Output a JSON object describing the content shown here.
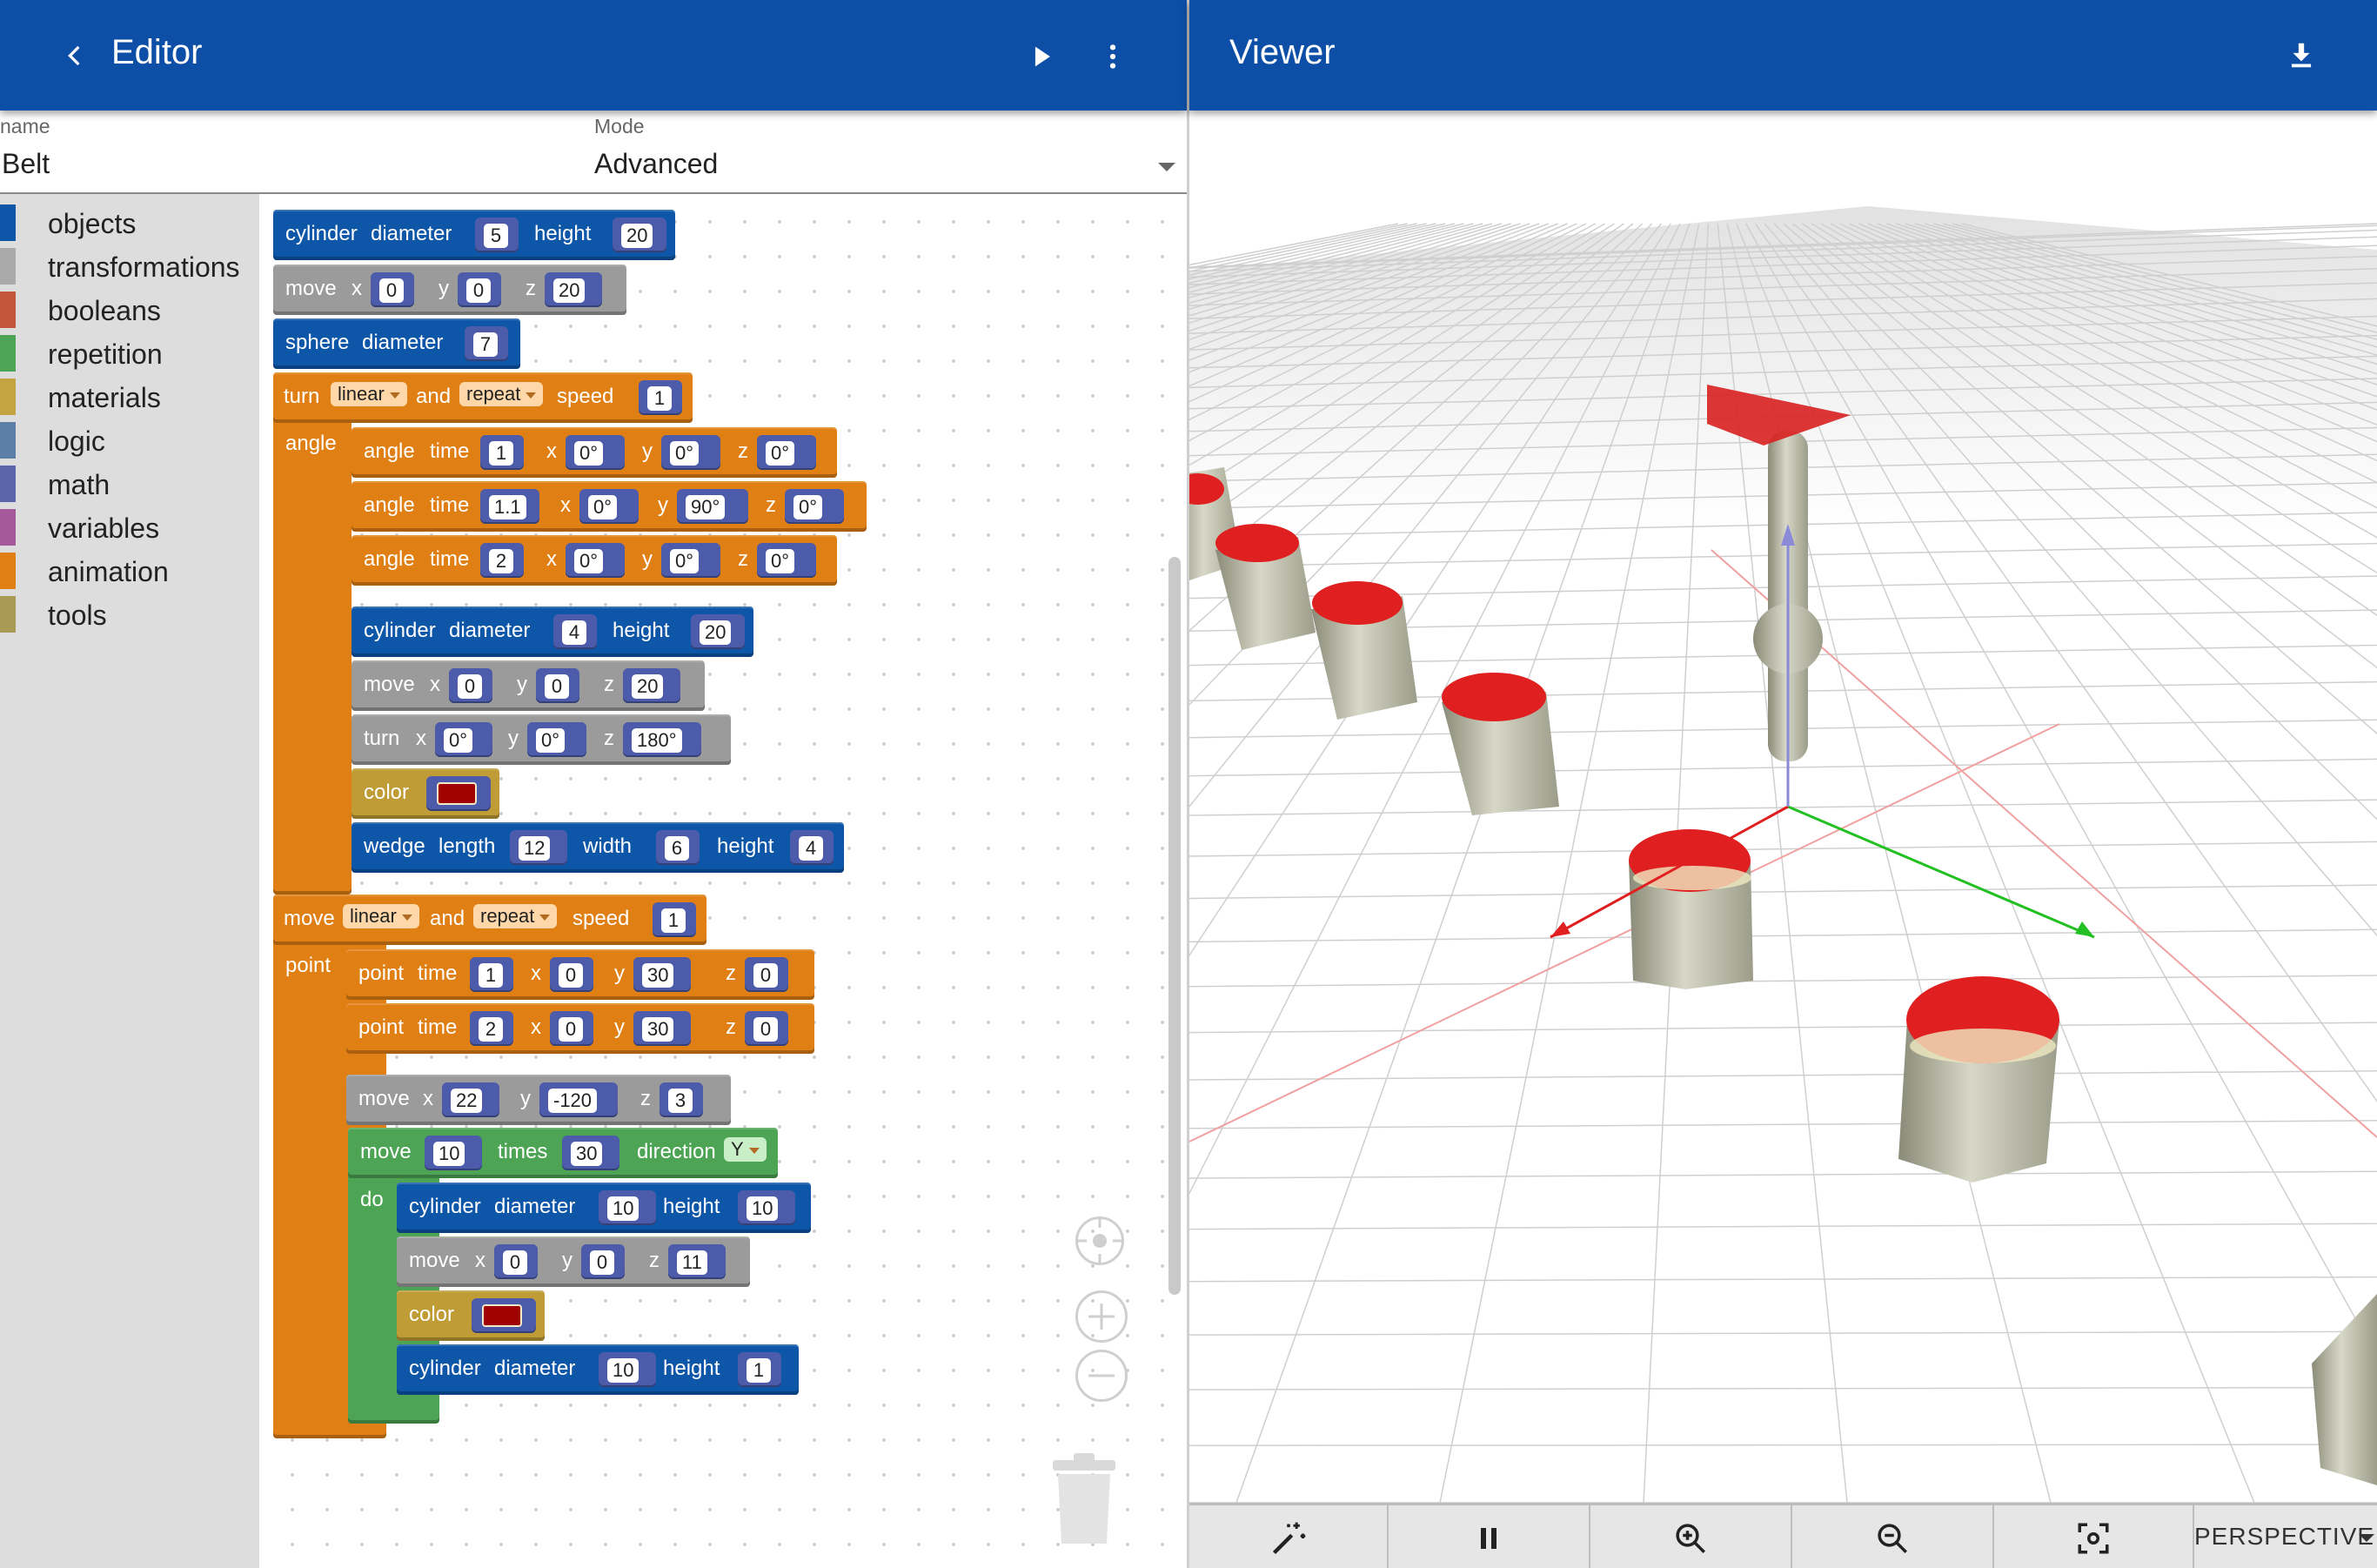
{
  "editor": {
    "title": "Editor",
    "name_label": "name",
    "name_value": "Belt",
    "mode_label": "Mode",
    "mode_value": "Advanced"
  },
  "viewer": {
    "title": "Viewer",
    "camera_mode": "PERSPECTIVE"
  },
  "toolbox": [
    {
      "label": "objects",
      "color": "#0e56a8"
    },
    {
      "label": "transformations",
      "color": "#aaaaaa"
    },
    {
      "label": "booleans",
      "color": "#c4563c"
    },
    {
      "label": "repetition",
      "color": "#4da455"
    },
    {
      "label": "materials",
      "color": "#c4a440"
    },
    {
      "label": "logic",
      "color": "#5b7fa6"
    },
    {
      "label": "math",
      "color": "#5b64a8"
    },
    {
      "label": "variables",
      "color": "#a5589a"
    },
    {
      "label": "animation",
      "color": "#e07f13"
    },
    {
      "label": "tools",
      "color": "#a89a55"
    }
  ],
  "blocks": {
    "b1": {
      "w": [
        "cylinder",
        "diameter",
        "height"
      ],
      "v": [
        "5",
        "20"
      ]
    },
    "b2": {
      "w": [
        "move",
        "x",
        "y",
        "z"
      ],
      "v": [
        "0",
        "0",
        "20"
      ]
    },
    "b3": {
      "w": [
        "sphere",
        "diameter"
      ],
      "v": [
        "7"
      ]
    },
    "b4": {
      "w": [
        "turn",
        "and",
        "speed",
        "angle"
      ],
      "d": [
        "linear",
        "repeat"
      ],
      "v": [
        "1"
      ]
    },
    "b5": {
      "w": [
        "angle",
        "time",
        "x",
        "y",
        "z"
      ],
      "v": [
        "1",
        "0°",
        "0°",
        "0°"
      ]
    },
    "b6": {
      "w": [
        "angle",
        "time",
        "x",
        "y",
        "z"
      ],
      "v": [
        "1.1",
        "0°",
        "90°",
        "0°"
      ]
    },
    "b7": {
      "w": [
        "angle",
        "time",
        "x",
        "y",
        "z"
      ],
      "v": [
        "2",
        "0°",
        "0°",
        "0°"
      ]
    },
    "b8": {
      "w": [
        "cylinder",
        "diameter",
        "height"
      ],
      "v": [
        "4",
        "20"
      ]
    },
    "b9": {
      "w": [
        "move",
        "x",
        "y",
        "z"
      ],
      "v": [
        "0",
        "0",
        "20"
      ]
    },
    "b10": {
      "w": [
        "turn",
        "x",
        "y",
        "z"
      ],
      "v": [
        "0°",
        "0°",
        "180°"
      ]
    },
    "b11": {
      "w": [
        "color"
      ],
      "swatch": "#a00000"
    },
    "b12": {
      "w": [
        "wedge",
        "length",
        "width",
        "height"
      ],
      "v": [
        "12",
        "6",
        "4"
      ]
    },
    "b13": {
      "w": [
        "move",
        "and",
        "speed",
        "point"
      ],
      "d": [
        "linear",
        "repeat"
      ],
      "v": [
        "1"
      ]
    },
    "b14": {
      "w": [
        "point",
        "time",
        "x",
        "y",
        "z"
      ],
      "v": [
        "1",
        "0",
        "30",
        "0"
      ]
    },
    "b15": {
      "w": [
        "point",
        "time",
        "x",
        "y",
        "z"
      ],
      "v": [
        "2",
        "0",
        "30",
        "0"
      ]
    },
    "b16": {
      "w": [
        "move",
        "x",
        "y",
        "z"
      ],
      "v": [
        "22",
        "-120",
        "3"
      ]
    },
    "b17": {
      "w": [
        "move",
        "times",
        "direction",
        "do"
      ],
      "v": [
        "10",
        "30"
      ],
      "d": [
        "Y"
      ]
    },
    "b18": {
      "w": [
        "cylinder",
        "diameter",
        "height"
      ],
      "v": [
        "10",
        "10"
      ]
    },
    "b19": {
      "w": [
        "move",
        "x",
        "y",
        "z"
      ],
      "v": [
        "0",
        "0",
        "11"
      ]
    },
    "b20": {
      "w": [
        "color"
      ],
      "swatch": "#a00000"
    },
    "b21": {
      "w": [
        "cylinder",
        "diameter",
        "height"
      ],
      "v": [
        "10",
        "1"
      ]
    }
  },
  "colors": {
    "appbar": "#0d4ea6",
    "objects": "#0e56a8",
    "transformations": "#9b9b9b",
    "animation": "#e07f13",
    "materials": "#bf9c36",
    "repetition": "#4da455"
  }
}
